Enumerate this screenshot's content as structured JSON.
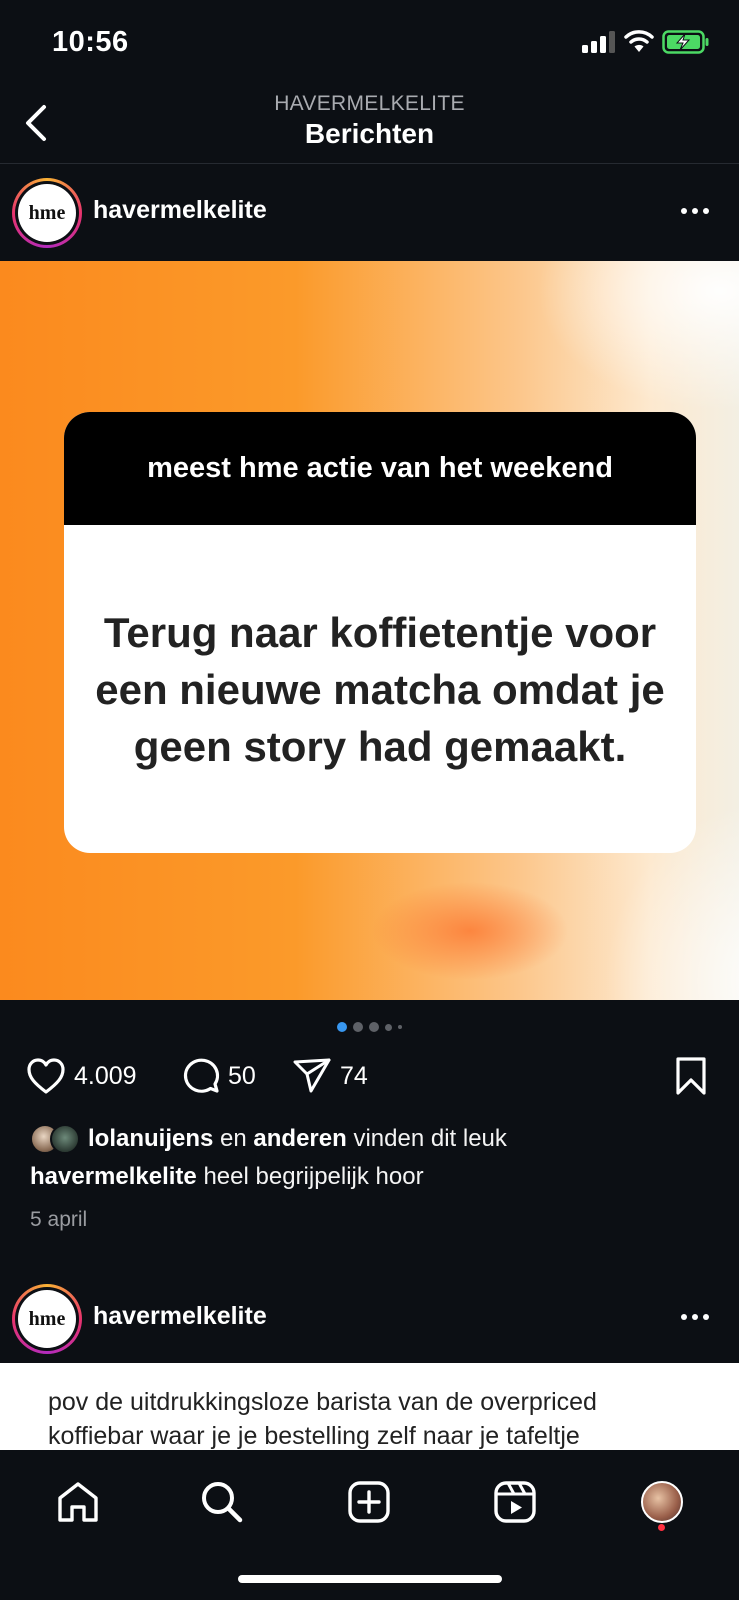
{
  "status": {
    "time": "10:56"
  },
  "nav": {
    "subtitle": "HAVERMELKELITE",
    "title": "Berichten"
  },
  "post": {
    "username": "havermelkelite",
    "avatar_text": "hme",
    "card_header": "meest hme actie van het weekend",
    "card_text": "Terug naar koffietentje voor een nieuwe matcha omdat je geen story had gemaakt.",
    "likes": "4.009",
    "comments": "50",
    "shares": "74",
    "liked_by_user": "lolanuijens",
    "liked_by_connector": "en",
    "liked_by_others": "anderen",
    "liked_by_suffix": "vinden dit leuk",
    "caption_user": "havermelkelite",
    "caption_text": "heel begrijpelijk hoor",
    "date": "5 april",
    "carousel_index": 1,
    "carousel_count": 5
  },
  "next_post": {
    "username": "havermelkelite",
    "avatar_text": "hme",
    "text_line1": "pov de uitdrukkingsloze barista van de overpriced",
    "text_line2": "koffiebar waar je je bestelling zelf naar je tafeltje"
  },
  "tabs": [
    "home-icon",
    "search-icon",
    "create-icon",
    "reels-icon",
    "profile-avatar"
  ],
  "colors": {
    "background": "#0c0f14",
    "accent_dot": "#3897f0",
    "notification": "#ff3040"
  }
}
